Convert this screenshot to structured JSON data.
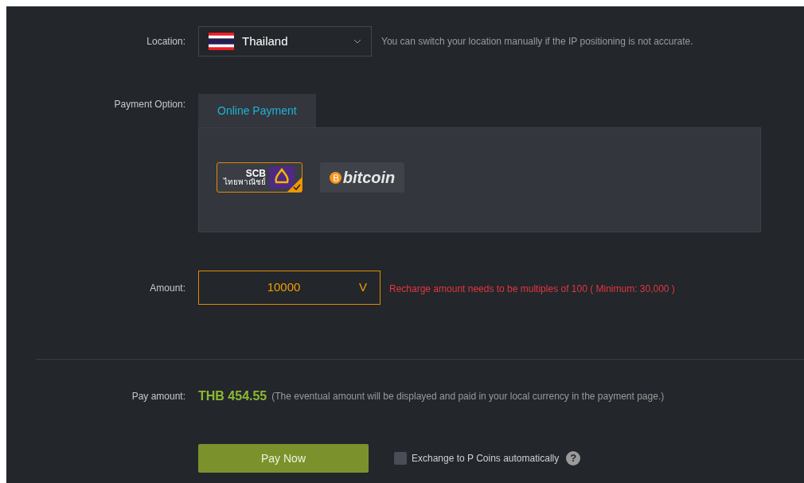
{
  "location": {
    "label": "Location:",
    "value": "Thailand",
    "hint": "You can switch your location manually if the IP positioning is not accurate."
  },
  "payment": {
    "label": "Payment Option:",
    "tabs": [
      {
        "label": "Online Payment",
        "selected": true
      }
    ],
    "methods": [
      {
        "kind": "scb",
        "title": "SCB",
        "subtitle": "ไทยพาณิชย์",
        "selected": true
      },
      {
        "kind": "bitcoin",
        "title": "bitcoin",
        "selected": false
      }
    ]
  },
  "amount": {
    "label": "Amount:",
    "value": "10000",
    "unit": "V",
    "error": "Recharge amount needs to be multiples of 100 ( Minimum: 30,000 )"
  },
  "pay": {
    "label": "Pay amount:",
    "value": "THB 454.55",
    "note": "(The eventual amount will be displayed and paid in your local currency in the payment page.)"
  },
  "button": "Pay Now",
  "exchange": {
    "label": "Exchange to P Coins automatically",
    "checked": false,
    "help": "?"
  }
}
